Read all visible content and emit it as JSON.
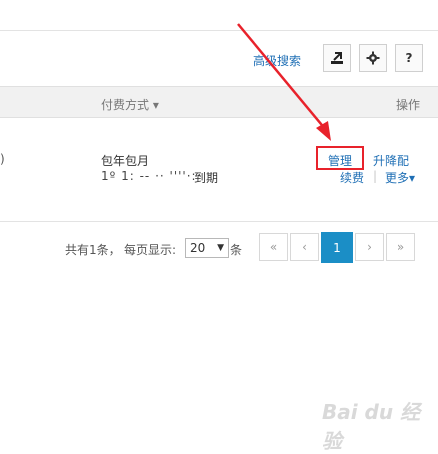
{
  "toolbar": {
    "advanced_search": "高级搜索",
    "export_icon": "export-icon",
    "settings_icon": "gear-icon",
    "help_label": "?"
  },
  "table": {
    "columns": {
      "payment": "付费方式 ▾",
      "actions": "操作"
    },
    "row": {
      "left_fragment": ")",
      "payment_type": "包年包月",
      "expiry_blurred": "1º 1:  -- ·· ''''·:·",
      "expiry_suffix": "到期",
      "actions": {
        "manage": "管理",
        "upgrade": "升降配",
        "renew": "续费",
        "separator": "|",
        "more": "更多▾"
      }
    }
  },
  "pagination": {
    "total": "共有1条，",
    "per_page_label": "每页显示:",
    "per_page_value": "20",
    "per_page_suffix": "条",
    "first": "«",
    "prev": "‹",
    "current": "1",
    "next": "›",
    "last": "»"
  },
  "watermark": {
    "text": "Bai du 经验"
  },
  "colors": {
    "accent": "#1b8ec6",
    "link": "#1f6fb5",
    "highlight": "#e8222b"
  }
}
